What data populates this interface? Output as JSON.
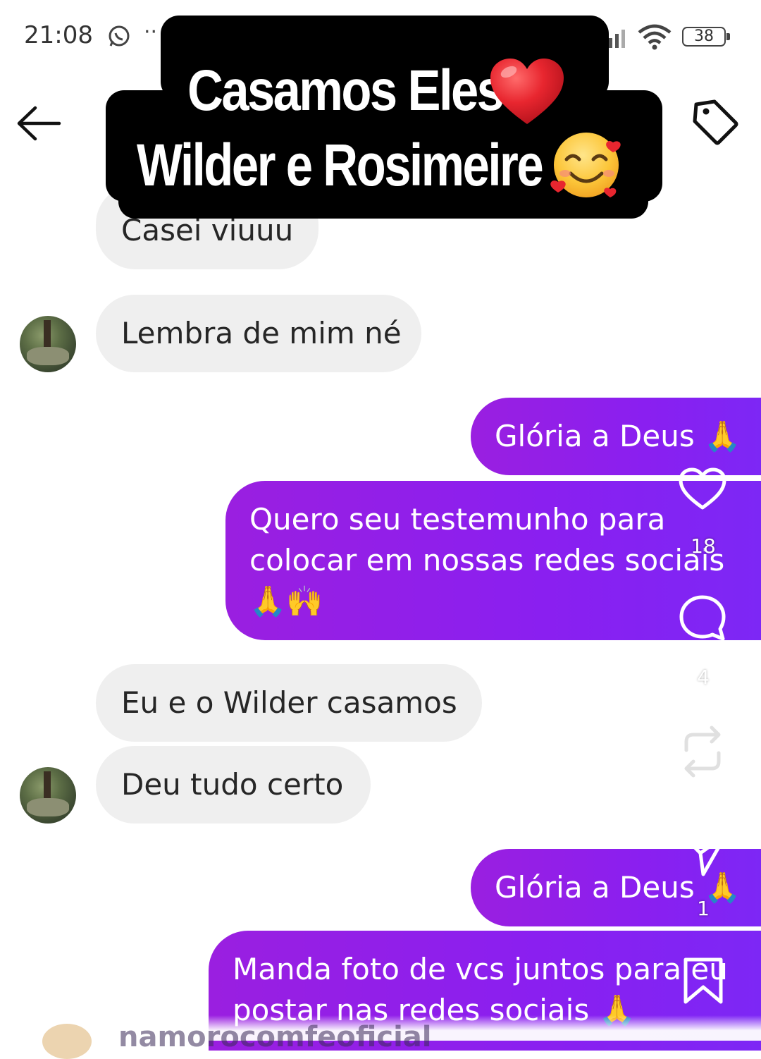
{
  "status_bar": {
    "time": "21:08",
    "dots": "··",
    "battery": "38"
  },
  "caption": {
    "line1": "Casamos Eles",
    "line2": "Wilder e Rosimeire",
    "line1_emoji": "red-heart-emoji",
    "line2_emoji": "smiling-face-with-hearts-emoji"
  },
  "messages": [
    {
      "side": "in",
      "text": "Casei viuuu"
    },
    {
      "side": "in",
      "text": "Lembra de mim né"
    },
    {
      "side": "out",
      "text": "Glória a Deus 🙏"
    },
    {
      "side": "out",
      "line1": "Quero seu testemunho para",
      "line2": "colocar em nossas redes sociais",
      "line3": "🙏🙌"
    },
    {
      "side": "in",
      "text": "Eu e o Wilder casamos"
    },
    {
      "side": "in",
      "text": "Deu tudo certo"
    },
    {
      "side": "out",
      "text": "Glória a Deus 🙏"
    },
    {
      "side": "out",
      "line1": "Manda foto de vcs juntos para eu",
      "line2": "postar nas redes sociais 🙏"
    }
  ],
  "actions": {
    "likes": "18",
    "comments": "4",
    "shares": "1"
  },
  "footer": {
    "username": "namorocomfeoficial"
  },
  "colors": {
    "outgoing_bubble": "#8a1ff0",
    "incoming_bubble": "#efefef",
    "caption_bg": "#000000"
  }
}
